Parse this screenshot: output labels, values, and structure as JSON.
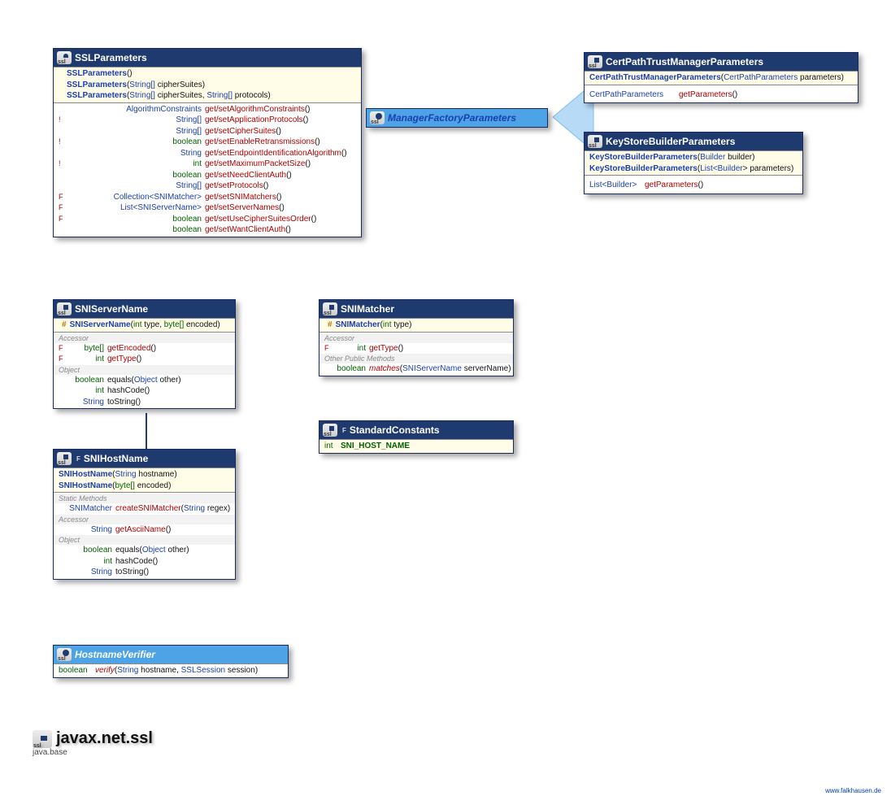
{
  "t_string": "String",
  "t_stringarr": "String[]",
  "t_int": "int",
  "t_bool": "boolean",
  "t_bytearr": "byte[]",
  "t_object": "Object",
  "t_list": "List",
  "t_builder": "Builder",
  "t_collection": "Collection",
  "sslparams": {
    "title": "SSLParameters",
    "c1": "SSLParameters",
    "c2": "SSLParameters",
    "c2_p": " cipherSuites",
    "c3": "SSLParameters",
    "c3_p1": " cipherSuites, ",
    "c3_p2": " protocols",
    "r1_ret": "AlgorithmConstraints",
    "r1_name": "get/setAlgorithmConstraints",
    "r2_name": "get/setApplicationProtocols",
    "r3_name": "get/setCipherSuites",
    "r4_name": "get/setEnableRetransmissions",
    "r5_name": "get/setEndpointIdentificationAlgorithm",
    "r6_name": "get/setMaximumPacketSize",
    "r7_name": "get/setNeedClientAuth",
    "r8_name": "get/setProtocols",
    "r9_ret1": "Collection<",
    "r9_ret2": "SNIMatcher",
    "r9_ret3": ">",
    "r9_name": "get/setSNIMatchers",
    "r10_ret1": "List<",
    "r10_ret2": "SNIServerName",
    "r10_ret3": ">",
    "r10_name": "get/setServerNames",
    "r11_name": "get/setUseCipherSuitesOrder",
    "r12_name": "get/setWantClientAuth"
  },
  "mfp": {
    "title": "ManagerFactoryParameters"
  },
  "cptmp": {
    "title": "CertPathTrustManagerParameters",
    "c1": "CertPathTrustManagerParameters",
    "c1_p_type": "CertPathParameters",
    "c1_p_name": " parameters",
    "m1_ret": "CertPathParameters",
    "m1_name": "getParameters"
  },
  "ksbp": {
    "title": "KeyStoreBuilderParameters",
    "c1": "KeyStoreBuilderParameters",
    "c1_p_type": "Builder",
    "c1_p_name": " builder",
    "c2": "KeyStoreBuilderParameters",
    "c2_p_pre": "List<",
    "c2_p_mid": "Builder",
    "c2_p_post": "> parameters",
    "m1_ret_pre": "List<",
    "m1_ret_mid": "Builder",
    "m1_ret_post": ">",
    "m1_name": "getParameters"
  },
  "snisn": {
    "title": "SNIServerName",
    "c1": "SNIServerName",
    "c1_p1": "int",
    "c1_p1n": " type, ",
    "c1_p2": "byte[]",
    "c1_p2n": " encoded",
    "sec1": "Accessor",
    "m1_ret": "byte[]",
    "m1_name": "getEncoded",
    "m2_ret": "int",
    "m2_name": "getType",
    "sec2": "Object",
    "m3_ret": "boolean",
    "m3_name": "equals",
    "m3_p_type": "Object",
    "m3_p_name": " other",
    "m4_ret": "int",
    "m4_name": "hashCode",
    "m5_ret": "String",
    "m5_name": "toString"
  },
  "snihn": {
    "title": "SNIHostName",
    "mod": "F",
    "c1": "SNIHostName",
    "c1_p_type": "String",
    "c1_p_name": " hostname",
    "c2": "SNIHostName",
    "c2_p_type": "byte[]",
    "c2_p_name": " encoded",
    "sec1": "Static Methods",
    "m1_ret": "SNIMatcher",
    "m1_name": "createSNIMatcher",
    "m1_p_type": "String",
    "m1_p_name": " regex",
    "sec2": "Accessor",
    "m2_ret": "String",
    "m2_name": "getAsciiName",
    "sec3": "Object",
    "m3_ret": "boolean",
    "m3_name": "equals",
    "m3_p_type": "Object",
    "m3_p_name": " other",
    "m4_ret": "int",
    "m4_name": "hashCode",
    "m5_ret": "String",
    "m5_name": "toString"
  },
  "snim": {
    "title": "SNIMatcher",
    "c1": "SNIMatcher",
    "c1_p_type": "int",
    "c1_p_name": " type",
    "sec1": "Accessor",
    "m1_ret": "int",
    "m1_name": "getType",
    "sec2": "Other Public Methods",
    "m2_ret": "boolean",
    "m2_name": "matches",
    "m2_p_type": "SNIServerName",
    "m2_p_name": " serverName"
  },
  "stdc": {
    "title": "StandardConstants",
    "mod": "F",
    "m1_ret": "int",
    "m1_name": "SNI_HOST_NAME"
  },
  "hv": {
    "title": "HostnameVerifier",
    "m1_ret": "boolean",
    "m1_name": "verify",
    "m1_p1_type": "String",
    "m1_p1_name": " hostname, ",
    "m1_p2_type": "SSLSession",
    "m1_p2_name": " session"
  },
  "pkg": {
    "title": "javax.net.ssl",
    "sub": "java.base"
  },
  "footer": "www.falkhausen.de"
}
